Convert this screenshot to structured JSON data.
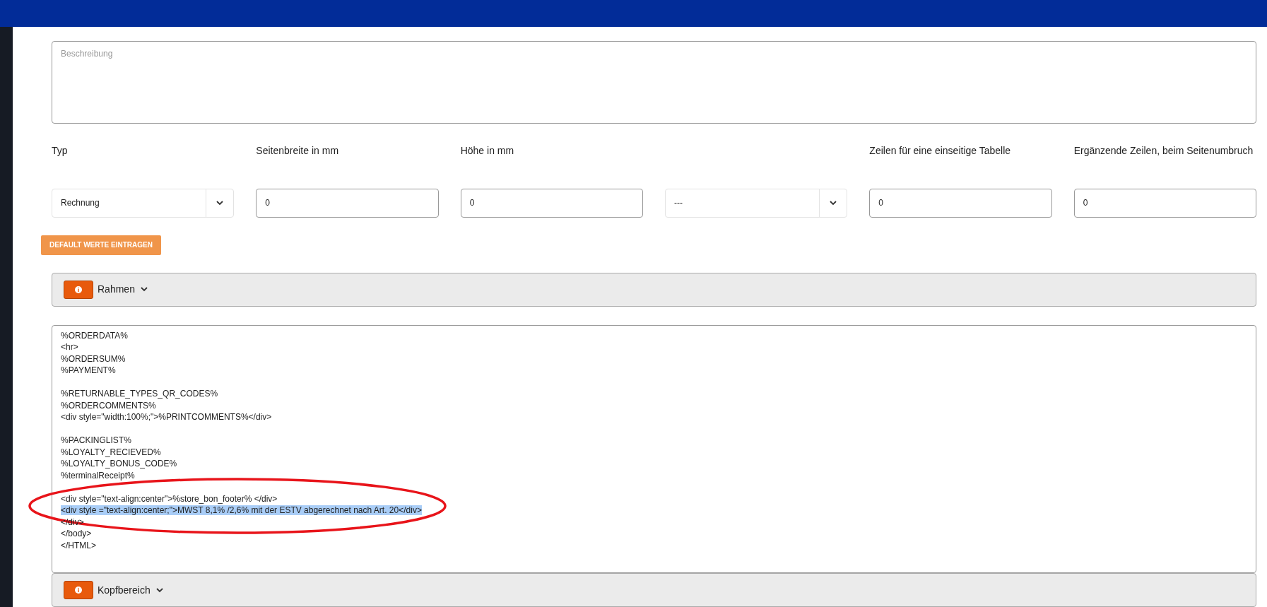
{
  "description": {
    "placeholder": "Beschreibung"
  },
  "fields": [
    {
      "kind": "select",
      "label": "Typ",
      "value": "Rechnung"
    },
    {
      "kind": "input",
      "label": "Seitenbreite in mm",
      "value": "0"
    },
    {
      "kind": "input",
      "label": "Höhe in mm",
      "value": "0"
    },
    {
      "kind": "select",
      "value": "---"
    },
    {
      "kind": "input",
      "label": "Zeilen für eine einseitige Tabelle",
      "value": "0"
    },
    {
      "kind": "input",
      "label": "Ergänzende Zeilen, beim Seitenumbruch",
      "value": "0"
    }
  ],
  "default_button": "DEFAULT WERTE EINTRAGEN",
  "sections": [
    {
      "title": "Rahmen",
      "expanded": false
    },
    {
      "title": "Kopfbereich",
      "expanded": false
    }
  ],
  "editor_lines": [
    {
      "kind": "text",
      "text": "%ORDERDATA%",
      "selected": false
    },
    {
      "kind": "text",
      "text": "<hr>",
      "selected": false
    },
    {
      "kind": "text",
      "text": "%ORDERSUM%",
      "selected": false
    },
    {
      "kind": "text",
      "text": "%PAYMENT%",
      "selected": false
    },
    {
      "kind": "blank"
    },
    {
      "kind": "text",
      "text": "%RETURNABLE_TYPES_QR_CODES%",
      "selected": false
    },
    {
      "kind": "text",
      "text": "%ORDERCOMMENTS%",
      "selected": false
    },
    {
      "kind": "text",
      "text": "<div style=\"width:100%;\">%PRINTCOMMENTS%</div>",
      "selected": false
    },
    {
      "kind": "blank"
    },
    {
      "kind": "text",
      "text": "%PACKINGLIST%",
      "selected": false
    },
    {
      "kind": "text",
      "text": "%LOYALTY_RECIEVED%",
      "selected": false
    },
    {
      "kind": "text",
      "text": "%LOYALTY_BONUS_CODE%",
      "selected": false
    },
    {
      "kind": "text",
      "text": "%terminalReceipt%",
      "selected": false
    },
    {
      "kind": "blank"
    },
    {
      "kind": "text",
      "text": "<div style=\"text-align:center\">%store_bon_footer% </div>",
      "selected": false
    },
    {
      "kind": "text",
      "text": "<div style =\"text-align:center;\">MWST 8,1% /2,6% mit der ESTV abgerechnet nach Art. 20</div>",
      "selected": true
    },
    {
      "kind": "text",
      "text": "</div>",
      "selected": false
    },
    {
      "kind": "text",
      "text": "</body>",
      "selected": false
    },
    {
      "kind": "text",
      "text": "</HTML>",
      "selected": false
    }
  ]
}
